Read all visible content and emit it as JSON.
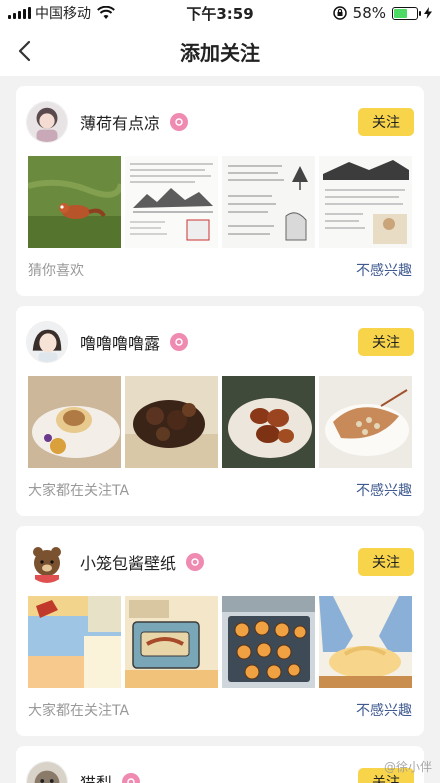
{
  "status_bar": {
    "carrier": "中国移动",
    "time": "下午3:59",
    "battery": "58%",
    "battery_level": 0.58,
    "icons": [
      "signal-icon",
      "wifi-icon",
      "rotation-lock-icon",
      "battery-icon",
      "charging-icon"
    ]
  },
  "nav": {
    "title": "添加关注",
    "back_icon": "chevron-left-icon"
  },
  "cards": [
    {
      "name": "薄荷有点凉",
      "follow_label": "关注",
      "reason": "猜你喜欢",
      "dismiss_label": "不感兴趣",
      "thumbs": [
        "red-panda-photo",
        "ink-painting-notes",
        "handwritten-notes",
        "illustrated-notes"
      ]
    },
    {
      "name": "噜噜噜噜露",
      "follow_label": "关注",
      "reason": "大家都在关注TA",
      "dismiss_label": "不感兴趣",
      "thumbs": [
        "dessert-plate-photo",
        "grilled-meat-photo",
        "braised-dish-photo",
        "seafood-dish-photo"
      ]
    },
    {
      "name": "小笼包酱壁纸",
      "follow_label": "关注",
      "reason": "大家都在关注TA",
      "dismiss_label": "不感兴趣",
      "thumbs": [
        "cartoon-room-drawing",
        "cartoon-oven-drawing",
        "cartoon-buns-drawing",
        "cartoon-kneading-drawing"
      ]
    },
    {
      "name": "猫梨",
      "follow_label": "关注"
    }
  ],
  "colors": {
    "follow_button": "#f7d449",
    "dismiss_link": "#3e5a90",
    "badge": "#ef8ab1",
    "battery_fill": "#4cd964"
  },
  "watermark": "@徐小伴"
}
